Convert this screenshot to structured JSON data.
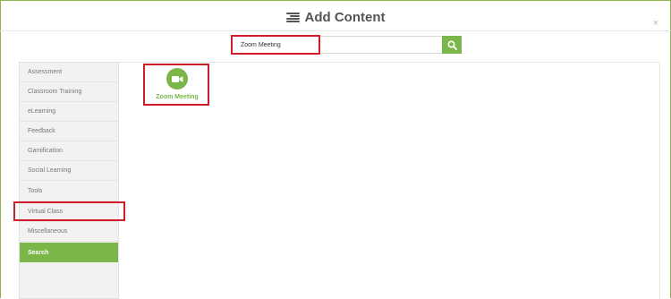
{
  "header": {
    "title": "Add Content",
    "close_glyph": "×"
  },
  "search": {
    "value": "Zoom Meeting"
  },
  "sidebar": {
    "items": [
      {
        "label": "Assessment",
        "active": false
      },
      {
        "label": "Classroom Training",
        "active": false
      },
      {
        "label": "eLearning",
        "active": false
      },
      {
        "label": "Feedback",
        "active": false
      },
      {
        "label": "Gamification",
        "active": false
      },
      {
        "label": "Social Learning",
        "active": false
      },
      {
        "label": "Tools",
        "active": false
      },
      {
        "label": "Virtual Class",
        "active": false
      },
      {
        "label": "Miscellaneous",
        "active": false
      },
      {
        "label": "Search",
        "active": true
      }
    ]
  },
  "results": [
    {
      "label": "Zoom Meeting",
      "icon": "video-camera-icon"
    }
  ],
  "colors": {
    "accent": "#7ab648",
    "highlight": "#d21b2b"
  }
}
